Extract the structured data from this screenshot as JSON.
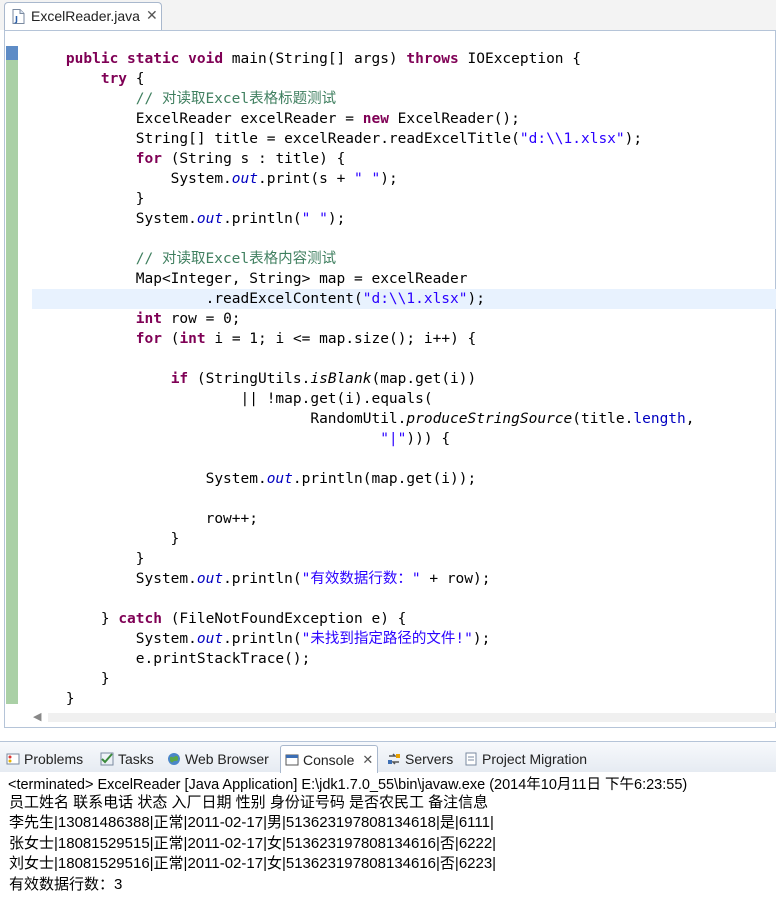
{
  "editor": {
    "tab": {
      "label": "ExcelReader.java",
      "close": "✕"
    }
  },
  "code": {
    "lines": [
      [
        [
          "    ",
          ""
        ],
        [
          "public static void",
          "kw"
        ],
        [
          " main(String[] args) ",
          ""
        ],
        [
          "throws",
          "kw"
        ],
        [
          " IOException {",
          ""
        ]
      ],
      [
        [
          "        ",
          ""
        ],
        [
          "try",
          "kw"
        ],
        [
          " {",
          ""
        ]
      ],
      [
        [
          "            ",
          ""
        ],
        [
          "// 对读取Excel表格标题测试",
          "cm"
        ]
      ],
      [
        [
          "            ExcelReader excelReader = ",
          ""
        ],
        [
          "new",
          "kw"
        ],
        [
          " ExcelReader();",
          ""
        ]
      ],
      [
        [
          "            String[] title = excelReader.readExcelTitle(",
          ""
        ],
        [
          "\"d:\\\\1.xlsx\"",
          "str"
        ],
        [
          ");",
          ""
        ]
      ],
      [
        [
          "            ",
          ""
        ],
        [
          "for",
          "kw"
        ],
        [
          " (String s : title) {",
          ""
        ]
      ],
      [
        [
          "                System.",
          ""
        ],
        [
          "out",
          "fld"
        ],
        [
          ".print(s + ",
          ""
        ],
        [
          "\" \"",
          "str"
        ],
        [
          ");",
          ""
        ]
      ],
      [
        [
          "            }",
          ""
        ]
      ],
      [
        [
          "            System.",
          ""
        ],
        [
          "out",
          "fld"
        ],
        [
          ".println(",
          ""
        ],
        [
          "\" \"",
          "str"
        ],
        [
          ");",
          ""
        ]
      ],
      [
        [
          "",
          ""
        ]
      ],
      [
        [
          "            ",
          ""
        ],
        [
          "// 对读取Excel表格内容测试",
          "cm"
        ]
      ],
      [
        [
          "            Map<Integer, String> map = excelReader",
          ""
        ]
      ],
      [
        [
          "                    .readExcelContent(",
          ""
        ],
        [
          "\"d:\\\\1.xlsx\"",
          "str"
        ],
        [
          ");",
          ""
        ]
      ],
      [
        [
          "            ",
          ""
        ],
        [
          "int",
          "kw"
        ],
        [
          " row = 0;",
          ""
        ]
      ],
      [
        [
          "            ",
          ""
        ],
        [
          "for",
          "kw"
        ],
        [
          " (",
          ""
        ],
        [
          "int",
          "kw"
        ],
        [
          " i = 1; i <= map.size(); i++) {",
          ""
        ]
      ],
      [
        [
          "",
          ""
        ]
      ],
      [
        [
          "                ",
          ""
        ],
        [
          "if",
          "kw"
        ],
        [
          " (StringUtils.",
          ""
        ],
        [
          "isBlank",
          "sm"
        ],
        [
          "(map.get(i))",
          ""
        ]
      ],
      [
        [
          "                        || !map.get(i).equals(",
          ""
        ]
      ],
      [
        [
          "                                RandomUtil.",
          ""
        ],
        [
          "produceStringSource",
          "sm"
        ],
        [
          "(title.",
          ""
        ],
        [
          "length",
          "fld2"
        ],
        [
          ",",
          ""
        ]
      ],
      [
        [
          "                                        ",
          ""
        ],
        [
          "\"|\"",
          "str"
        ],
        [
          "))) {",
          ""
        ]
      ],
      [
        [
          "",
          ""
        ]
      ],
      [
        [
          "                    System.",
          ""
        ],
        [
          "out",
          "fld"
        ],
        [
          ".println(map.get(i));",
          ""
        ]
      ],
      [
        [
          "",
          ""
        ]
      ],
      [
        [
          "                    row++;",
          ""
        ]
      ],
      [
        [
          "                }",
          ""
        ]
      ],
      [
        [
          "            }",
          ""
        ]
      ],
      [
        [
          "            System.",
          ""
        ],
        [
          "out",
          "fld"
        ],
        [
          ".println(",
          ""
        ],
        [
          "\"有效数据行数：\"",
          "str"
        ],
        [
          " + row);",
          ""
        ]
      ],
      [
        [
          "",
          ""
        ]
      ],
      [
        [
          "        } ",
          ""
        ],
        [
          "catch",
          "kw"
        ],
        [
          " (FileNotFoundException e) {",
          ""
        ]
      ],
      [
        [
          "            System.",
          ""
        ],
        [
          "out",
          "fld"
        ],
        [
          ".println(",
          ""
        ],
        [
          "\"未找到指定路径的文件!\"",
          "str"
        ],
        [
          ");",
          ""
        ]
      ],
      [
        [
          "            e.printStackTrace();",
          ""
        ]
      ],
      [
        [
          "        }",
          ""
        ]
      ],
      [
        [
          "    }",
          ""
        ]
      ]
    ]
  },
  "views": {
    "tabs": [
      {
        "label": "Problems",
        "icon": "problems-icon",
        "active": false
      },
      {
        "label": "Tasks",
        "icon": "tasks-icon",
        "active": false
      },
      {
        "label": "Web Browser",
        "icon": "globe-icon",
        "active": false
      },
      {
        "label": "Console",
        "icon": "console-icon",
        "active": true,
        "close": "✕"
      },
      {
        "label": "Servers",
        "icon": "servers-icon",
        "active": false
      },
      {
        "label": "Project Migration",
        "icon": "migration-icon",
        "active": false
      }
    ]
  },
  "console": {
    "title": "<terminated> ExcelReader [Java Application] E:\\jdk1.7.0_55\\bin\\javaw.exe (2014年10月11日 下午6:23:55)",
    "lines": [
      "员工姓名 联系电话 状态 入厂日期 性别 身份证号码 是否农民工 备注信息",
      "李先生|13081486388|正常|2011-02-17|男|513623197808134618|是|6111|",
      "张女士|18081529515|正常|2011-02-17|女|513623197808134616|否|6222|",
      "刘女士|18081529516|正常|2011-02-17|女|513623197808134616|否|6223|",
      "有效数据行数：3"
    ]
  }
}
